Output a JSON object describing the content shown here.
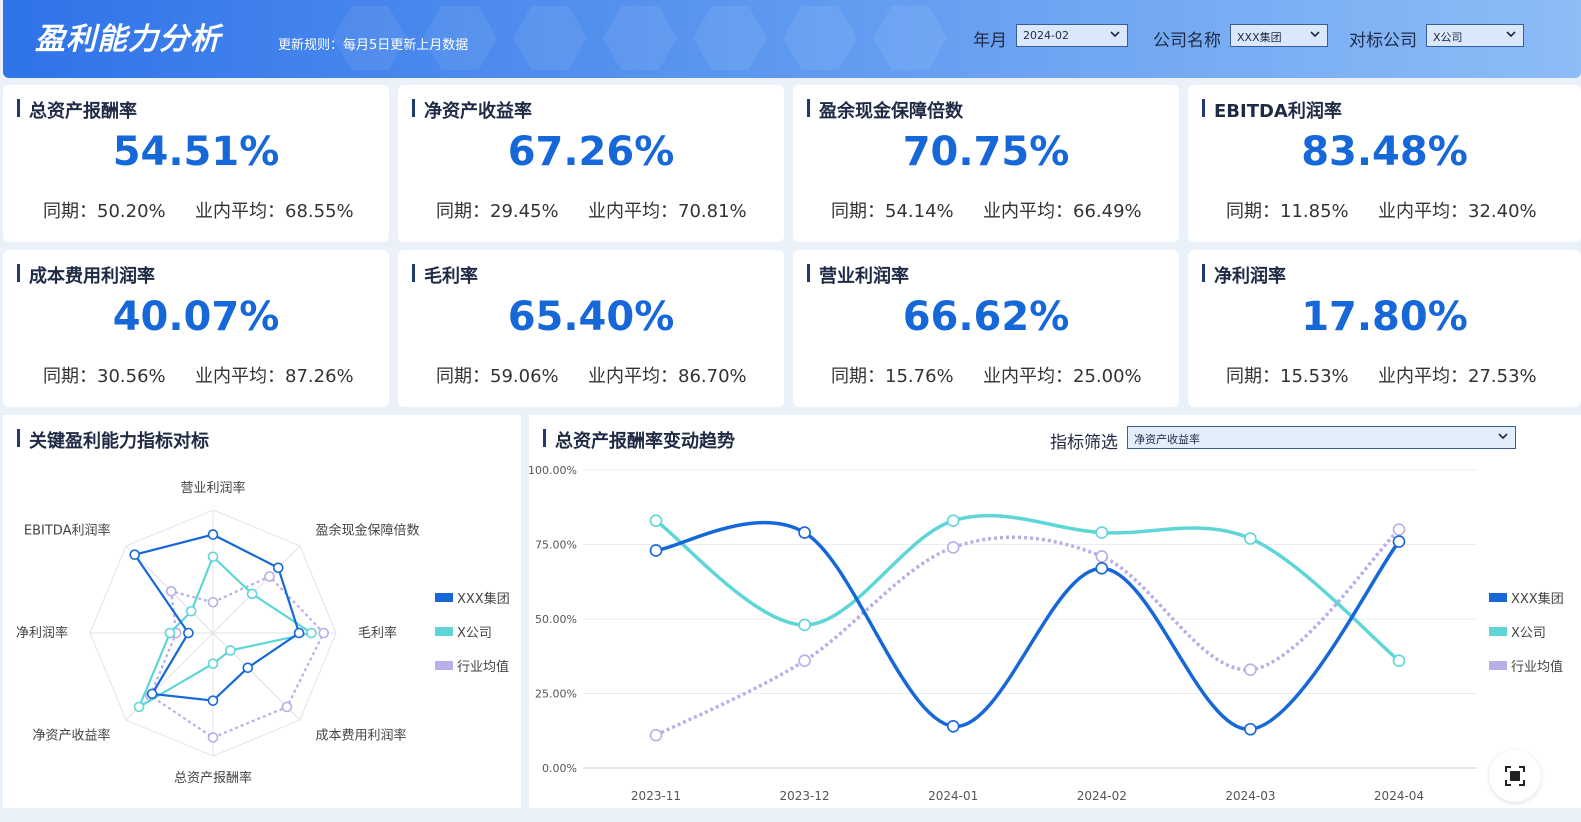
{
  "header": {
    "title": "盈利能力分析",
    "rule": "更新规则：每月5日更新上月数据",
    "filters": [
      {
        "label": "年月",
        "value": "2024-02"
      },
      {
        "label": "公司名称",
        "value": "XXX集团"
      },
      {
        "label": "对标公司",
        "value": "X公司"
      }
    ]
  },
  "kpis": [
    {
      "title": "总资产报酬率",
      "value": "54.51%",
      "yoy": "同期：50.20%",
      "avg": "业内平均：68.55%"
    },
    {
      "title": "净资产收益率",
      "value": "67.26%",
      "yoy": "同期：29.45%",
      "avg": "业内平均：70.81%"
    },
    {
      "title": "盈余现金保障倍数",
      "value": "70.75%",
      "yoy": "同期：54.14%",
      "avg": "业内平均：66.49%"
    },
    {
      "title": "EBITDA利润率",
      "value": "83.48%",
      "yoy": "同期：11.85%",
      "avg": "业内平均：32.40%"
    },
    {
      "title": "成本费用利润率",
      "value": "40.07%",
      "yoy": "同期：30.56%",
      "avg": "业内平均：87.26%"
    },
    {
      "title": "毛利率",
      "value": "65.40%",
      "yoy": "同期：59.06%",
      "avg": "业内平均：86.70%"
    },
    {
      "title": "营业利润率",
      "value": "66.62%",
      "yoy": "同期：15.76%",
      "avg": "业内平均：25.00%"
    },
    {
      "title": "净利润率",
      "value": "17.80%",
      "yoy": "同期：15.53%",
      "avg": "业内平均：27.53%"
    }
  ],
  "radar_panel": {
    "title": "关键盈利能力指标对标"
  },
  "trend_panel": {
    "title": "总资产报酬率变动趋势",
    "filter_label": "指标筛选",
    "filter_value": "净资产收益率"
  },
  "colors": {
    "primary": "#1667d8",
    "teal": "#5ed6d8",
    "lavender": "#b9aee8"
  },
  "chart_data": [
    {
      "type": "radar",
      "axes": [
        "营业利润率",
        "盈余现金保障倍数",
        "毛利率",
        "成本费用利润率",
        "总资产报酬率",
        "净资产收益率",
        "净利润率",
        "EBITDA利润率"
      ],
      "max": 100,
      "series": [
        {
          "name": "XXX集团",
          "color": "#1667d8",
          "values": [
            80,
            75,
            70,
            40,
            55,
            70,
            20,
            90
          ]
        },
        {
          "name": "X公司",
          "color": "#5ed6d8",
          "values": [
            62,
            45,
            80,
            20,
            25,
            85,
            35,
            25
          ]
        },
        {
          "name": "行业均值",
          "color": "#b9aee8",
          "values": [
            25,
            65,
            90,
            85,
            85,
            72,
            30,
            48
          ]
        }
      ]
    },
    {
      "type": "line",
      "categories": [
        "2023-11",
        "2023-12",
        "2024-01",
        "2024-02",
        "2024-03",
        "2024-04"
      ],
      "yticks": [
        "0.00%",
        "25.00%",
        "50.00%",
        "75.00%",
        "100.00%"
      ],
      "ylim": [
        0,
        100
      ],
      "series": [
        {
          "name": "XXX集团",
          "color": "#1667d8",
          "values": [
            73,
            79,
            14,
            67,
            13,
            76
          ]
        },
        {
          "name": "X公司",
          "color": "#5ed6d8",
          "values": [
            83,
            48,
            83,
            79,
            77,
            36
          ]
        },
        {
          "name": "行业均值",
          "color": "#b9aee8",
          "values": [
            11,
            36,
            74,
            71,
            33,
            80
          ]
        }
      ]
    }
  ]
}
